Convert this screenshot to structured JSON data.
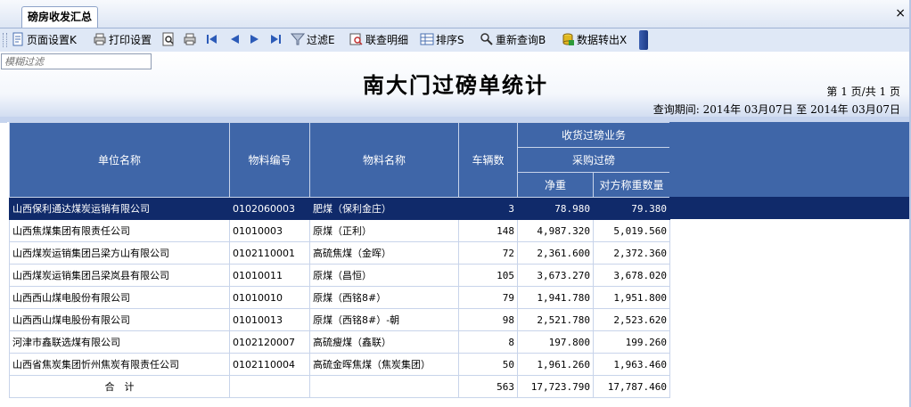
{
  "tab": {
    "label": "磅房收发汇总",
    "close": "×"
  },
  "toolbar": {
    "page_setup": "页面设置K",
    "print_setup": "打印设置",
    "filter": "过滤E",
    "join_detail": "联查明细",
    "sort": "排序S",
    "requery": "重新查询B",
    "export": "数据转出X"
  },
  "filter_input": {
    "placeholder": "模糊过滤"
  },
  "report": {
    "title": "南大门过磅单统计",
    "page_info": "第 1 页/共 1 页",
    "period": "查询期间: 2014年 03月07日 至 2014年 03月07日"
  },
  "grid": {
    "headers": {
      "unit": "单位名称",
      "material_code": "物料编号",
      "material_name": "物料名称",
      "vehicles": "车辆数",
      "group1": "收货过磅业务",
      "group2": "采购过磅",
      "net": "净重",
      "counter": "对方称重数量"
    },
    "rows": [
      [
        "山西保利通达煤炭运销有限公司",
        "0102060003",
        "肥煤（保利金庄）",
        "3",
        "78.980",
        "79.380"
      ],
      [
        "山西焦煤集团有限责任公司",
        "01010003",
        "原煤（正利）",
        "148",
        "4,987.320",
        "5,019.560"
      ],
      [
        "山西煤炭运销集团吕梁方山有限公司",
        "0102110001",
        "高硫焦煤（金晖）",
        "72",
        "2,361.600",
        "2,372.360"
      ],
      [
        "山西煤炭运销集团吕梁岚县有限公司",
        "01010011",
        "原煤（昌恒）",
        "105",
        "3,673.270",
        "3,678.020"
      ],
      [
        "山西西山煤电股份有限公司",
        "01010010",
        "原煤（西铭8#）",
        "79",
        "1,941.780",
        "1,951.800"
      ],
      [
        "山西西山煤电股份有限公司",
        "01010013",
        "原煤（西铭8#）-朝",
        "98",
        "2,521.780",
        "2,523.620"
      ],
      [
        "河津市鑫联选煤有限公司",
        "0102120007",
        "高硫瘦煤（鑫联）",
        "8",
        "197.800",
        "199.260"
      ],
      [
        "山西省焦炭集团忻州焦炭有限责任公司",
        "0102110004",
        "高硫金晖焦煤（焦炭集团）",
        "50",
        "1,961.260",
        "1,963.460"
      ]
    ],
    "total": {
      "label": "合　计",
      "vehicles": "563",
      "net": "17,723.790",
      "counter": "17,787.460"
    }
  }
}
